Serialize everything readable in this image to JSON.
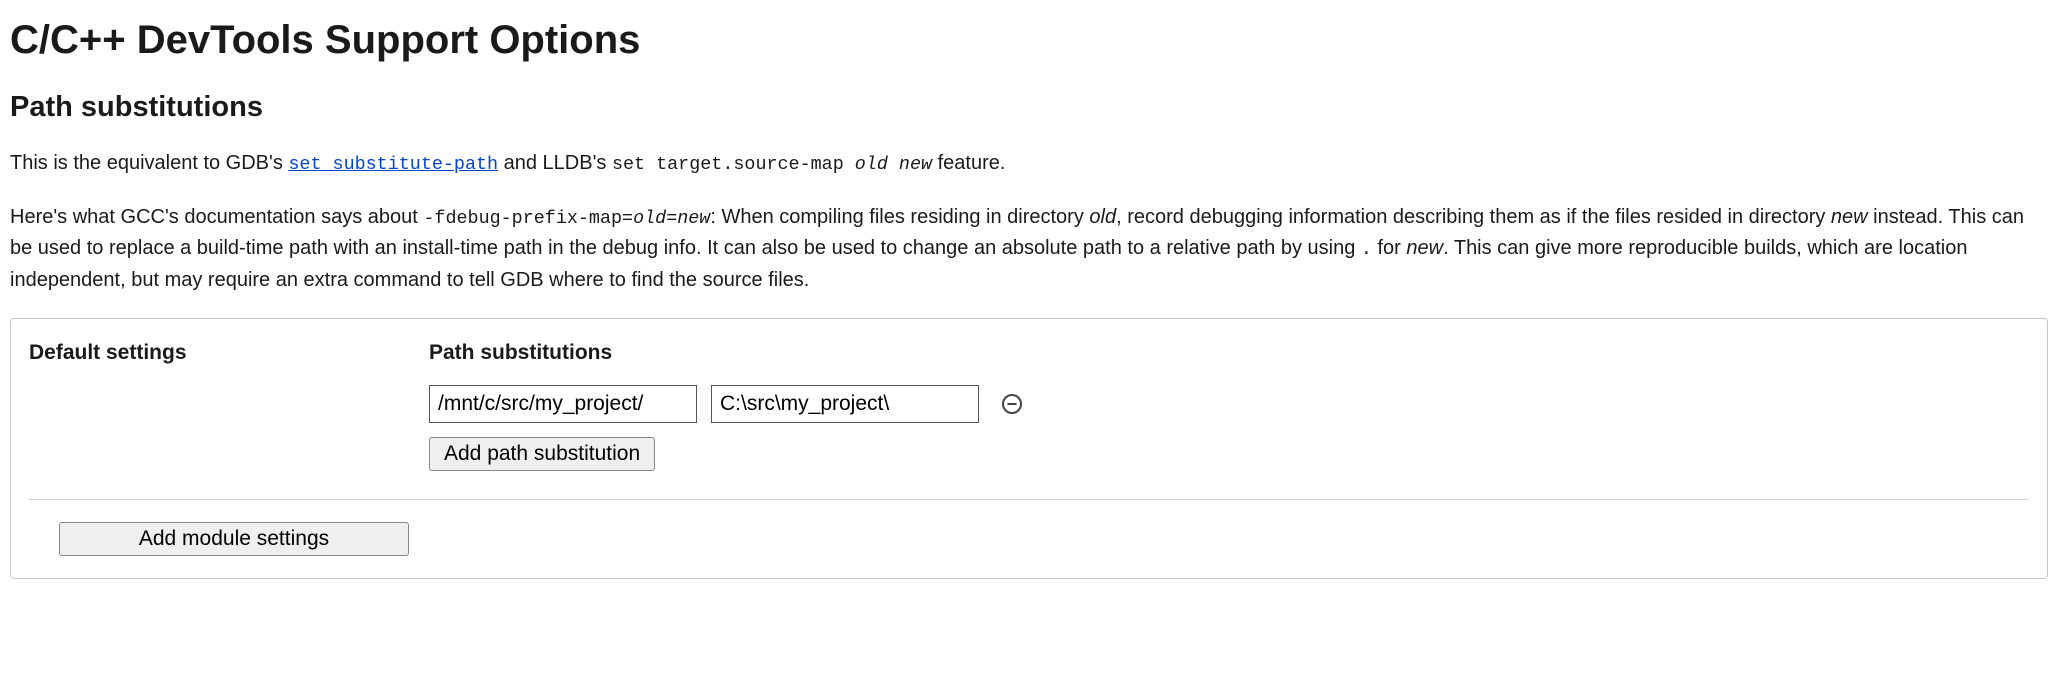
{
  "page_title": "C/C++ DevTools Support Options",
  "section_heading": "Path substitutions",
  "intro": {
    "prefix": "This is the equivalent to GDB's ",
    "link_text": "set substitute-path",
    "mid": " and LLDB's ",
    "code_text": "set target.source-map ",
    "code_old": "old",
    "code_sp": " ",
    "code_new": "new",
    "suffix": " feature."
  },
  "gcc_para": {
    "t1": "Here's what GCC's documentation says about ",
    "flag_prefix": "-fdebug-prefix-map=",
    "flag_old": "old",
    "flag_eq": "=",
    "flag_new": "new",
    "t2": ": When compiling files residing in directory ",
    "old_ital": "old",
    "t3": ", record debugging information describing them as if the files resided in directory ",
    "new_ital": "new",
    "t4": " instead. This can be used to replace a build-time path with an install-time path in the debug info. It can also be used to change an absolute path to a relative path by using ",
    "dot_mono": ".",
    "t5": " for ",
    "new_ital2": "new",
    "t6": ". This can give more reproducible builds, which are location independent, but may require an extra command to tell GDB where to find the source files."
  },
  "panel": {
    "default_settings_label": "Default settings",
    "path_subs_label": "Path substitutions",
    "row": {
      "from": "/mnt/c/src/my_project/",
      "to": "C:\\src\\my_project\\"
    },
    "add_path_button": "Add path substitution",
    "add_module_button": "Add module settings"
  }
}
